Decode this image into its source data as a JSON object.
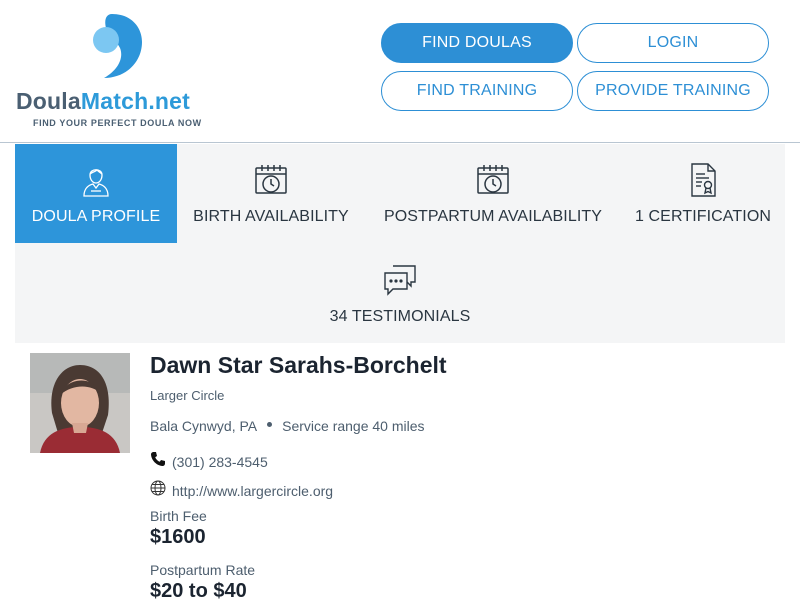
{
  "brand": {
    "name_part1": "Doula",
    "name_part2": "Match.net",
    "tagline": "FIND YOUR PERFECT DOULA NOW"
  },
  "nav": {
    "find_doulas": "FIND DOULAS",
    "login": "LOGIN",
    "find_training": "FIND TRAINING",
    "provide_training": "PROVIDE TRAINING"
  },
  "tabs": [
    {
      "label": "DOULA PROFILE",
      "icon": "person-icon",
      "active": true
    },
    {
      "label": "BIRTH AVAILABILITY",
      "icon": "calendar-clock-icon",
      "active": false
    },
    {
      "label": "POSTPARTUM AVAILABILITY",
      "icon": "calendar-clock-icon",
      "active": false
    },
    {
      "label": "1 CERTIFICATION",
      "icon": "certificate-icon",
      "active": false
    },
    {
      "label": "34 TESTIMONIALS",
      "icon": "chat-bubbles-icon",
      "active": false
    }
  ],
  "profile": {
    "name": "Dawn Star Sarahs-Borchelt",
    "organization": "Larger Circle",
    "location": "Bala Cynwyd, PA",
    "service_range": "Service range 40 miles",
    "phone": "(301) 283-4545",
    "website": "http://www.largercircle.org",
    "birth_fee_label": "Birth Fee",
    "birth_fee": "$1600",
    "postpartum_label": "Postpartum Rate",
    "postpartum_rate": "$20 to $40"
  },
  "colors": {
    "accent": "#2d8fd5",
    "text_dark": "#1b2430",
    "text_muted": "#4d5e6e",
    "tab_bg": "#f4f5f6"
  }
}
